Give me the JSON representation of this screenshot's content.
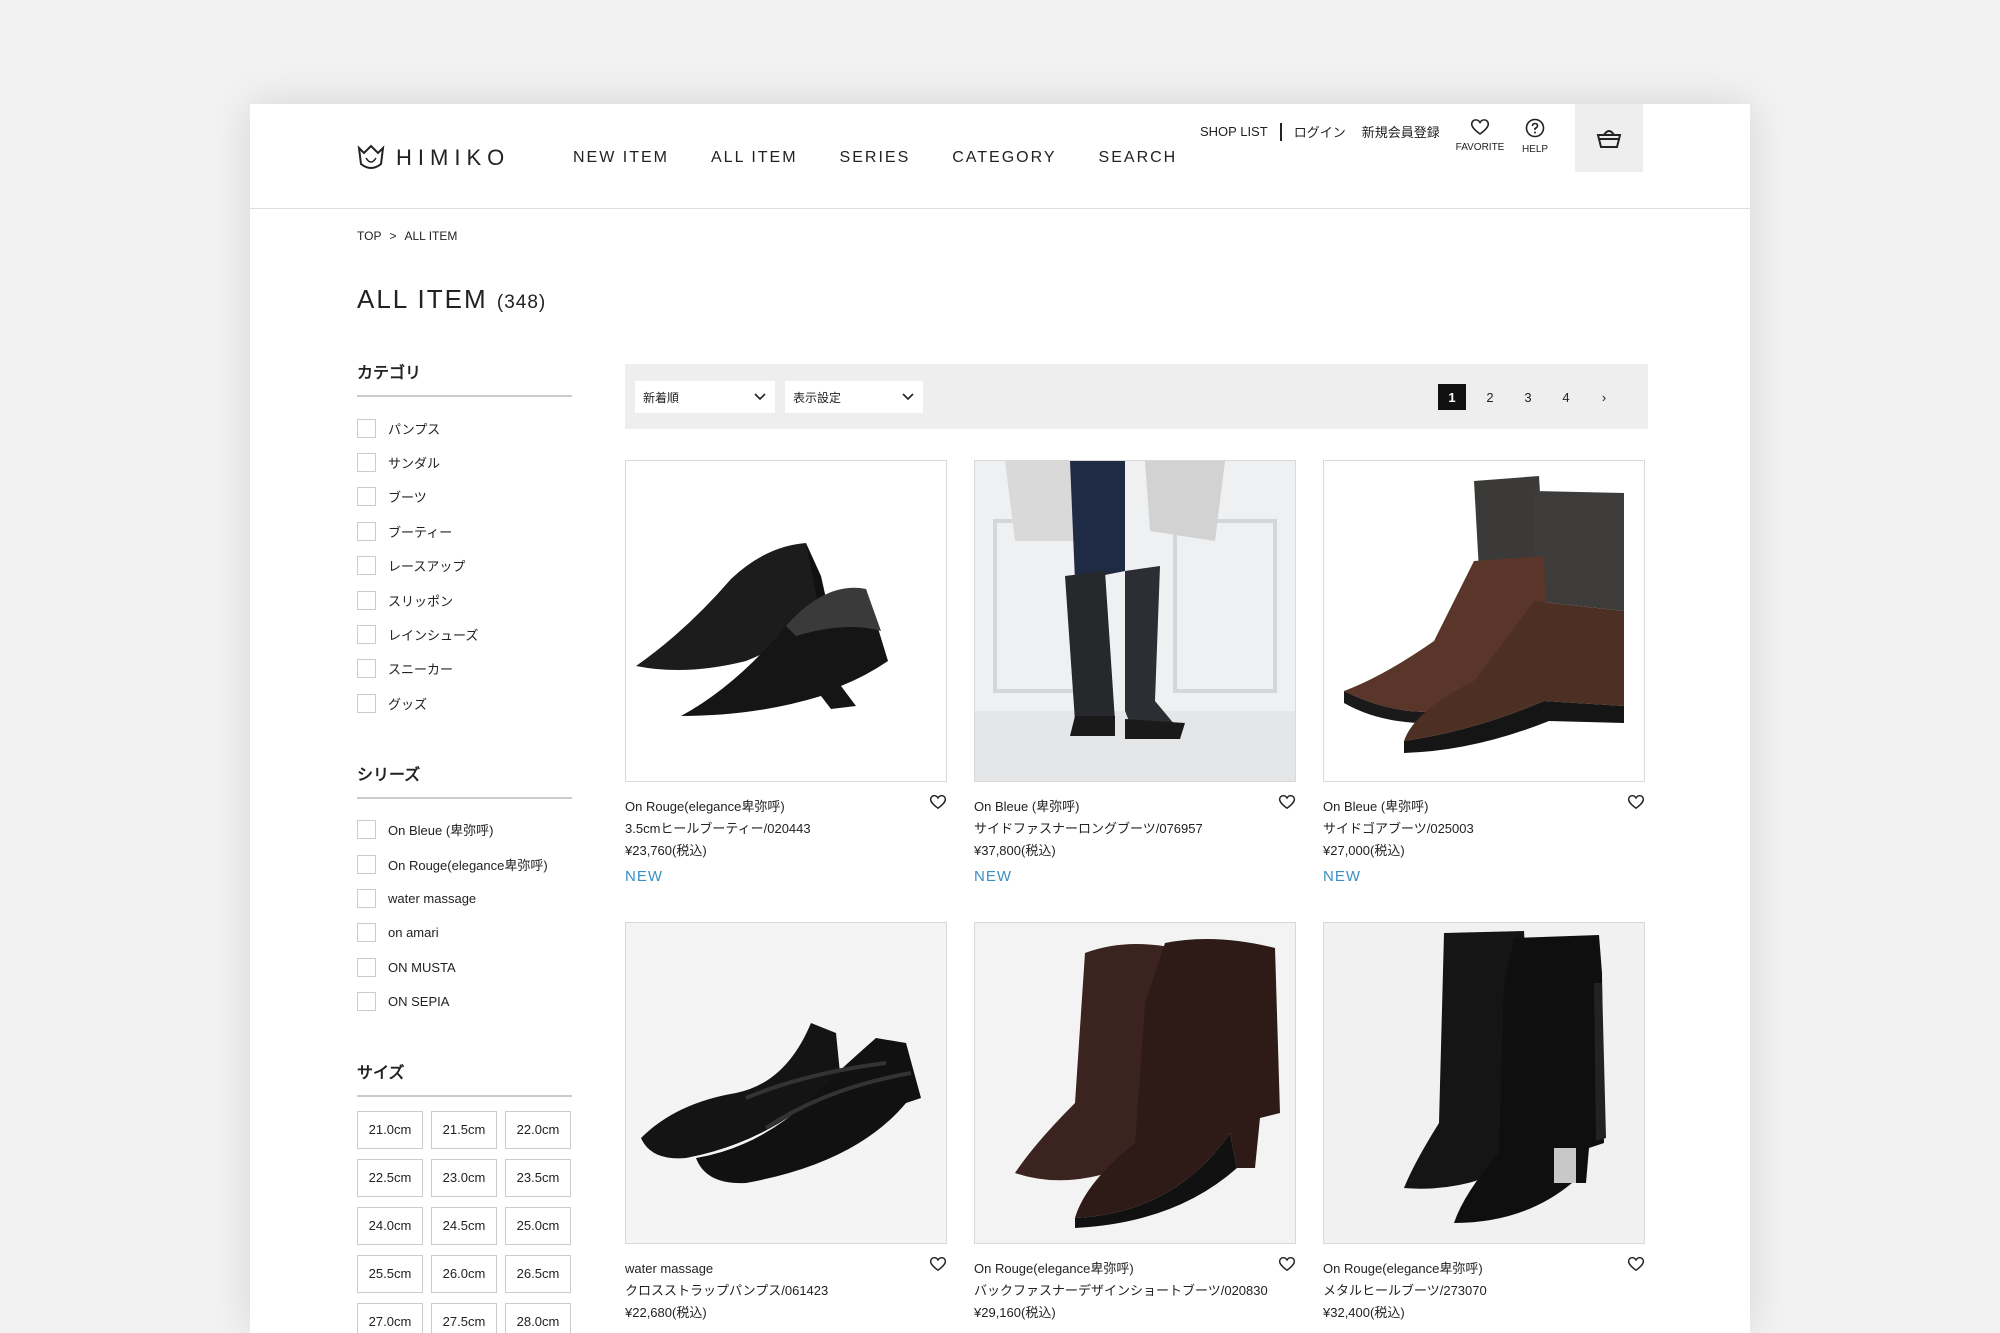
{
  "brand": {
    "name": "HIMIKO"
  },
  "nav": [
    "NEW ITEM",
    "ALL ITEM",
    "SERIES",
    "CATEGORY",
    "SEARCH"
  ],
  "util": {
    "shop_list": "SHOP LIST",
    "login": "ログイン",
    "register": "新規会員登録",
    "favorite": "FAVORITE",
    "help": "HELP"
  },
  "breadcrumb": {
    "top": "TOP",
    "sep": ">",
    "current": "ALL ITEM"
  },
  "page": {
    "title": "ALL ITEM",
    "count": "(348)"
  },
  "filters": {
    "category_title": "カテゴリ",
    "categories": [
      "パンプス",
      "サンダル",
      "ブーツ",
      "ブーティー",
      "レースアップ",
      "スリッポン",
      "レインシューズ",
      "スニーカー",
      "グッズ"
    ],
    "series_title": "シリーズ",
    "series": [
      "On Bleue (卑弥呼)",
      "On Rouge(elegance卑弥呼)",
      "water massage",
      "on amari",
      "ON MUSTA",
      "ON SEPIA"
    ],
    "size_title": "サイズ",
    "sizes": [
      "21.0cm",
      "21.5cm",
      "22.0cm",
      "22.5cm",
      "23.0cm",
      "23.5cm",
      "24.0cm",
      "24.5cm",
      "25.0cm",
      "25.5cm",
      "26.0cm",
      "26.5cm",
      "27.0cm",
      "27.5cm",
      "28.0cm"
    ]
  },
  "sort": {
    "order": "新着順",
    "display": "表示設定"
  },
  "pager": {
    "pages": [
      "1",
      "2",
      "3",
      "4"
    ],
    "current": "1",
    "next": "›"
  },
  "products": [
    {
      "series": "On Rouge(elegance卑弥呼)",
      "name": "3.5cmヒールブーティー/020443",
      "price": "¥23,760(税込)",
      "badge": "NEW"
    },
    {
      "series": "On Bleue (卑弥呼)",
      "name": "サイドファスナーロングブーツ/076957",
      "price": "¥37,800(税込)",
      "badge": "NEW"
    },
    {
      "series": "On Bleue (卑弥呼)",
      "name": "サイドゴアブーツ/025003",
      "price": "¥27,000(税込)",
      "badge": "NEW"
    },
    {
      "series": "water massage",
      "name": "クロスストラップパンプス/061423",
      "price": "¥22,680(税込)",
      "badge": ""
    },
    {
      "series": "On Rouge(elegance卑弥呼)",
      "name": "バックファスナーデザインショートブーツ/020830",
      "price": "¥29,160(税込)",
      "badge": ""
    },
    {
      "series": "On Rouge(elegance卑弥呼)",
      "name": "メタルヒールブーツ/273070",
      "price": "¥32,400(税込)",
      "badge": ""
    }
  ],
  "colors": {
    "accent": "#3a8fc4",
    "dark": "#111111",
    "bar": "#eeeeee"
  }
}
